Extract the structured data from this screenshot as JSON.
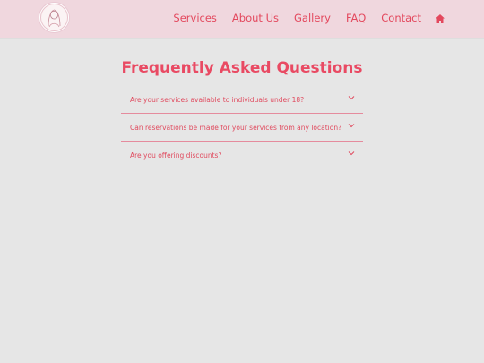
{
  "nav": {
    "logo_icon": "illustrated-portrait-logo",
    "links": [
      "Services",
      "About Us",
      "Gallery",
      "FAQ",
      "Contact"
    ],
    "home_icon": "home-icon"
  },
  "faq": {
    "title": "Frequently Asked Questions",
    "items": [
      {
        "question": "Are your services available to individuals under 18?",
        "icon": "chevron-down-icon"
      },
      {
        "question": "Can reservations be made for your services from any location?",
        "icon": "chevron-down-icon"
      },
      {
        "question": "Are you offering discounts?",
        "icon": "chevron-down-icon"
      }
    ]
  },
  "colors": {
    "navbar_bg": "#f0d7de",
    "page_bg": "#e6e6e6",
    "accent": "#e94a63",
    "divider": "#e58b9d"
  }
}
